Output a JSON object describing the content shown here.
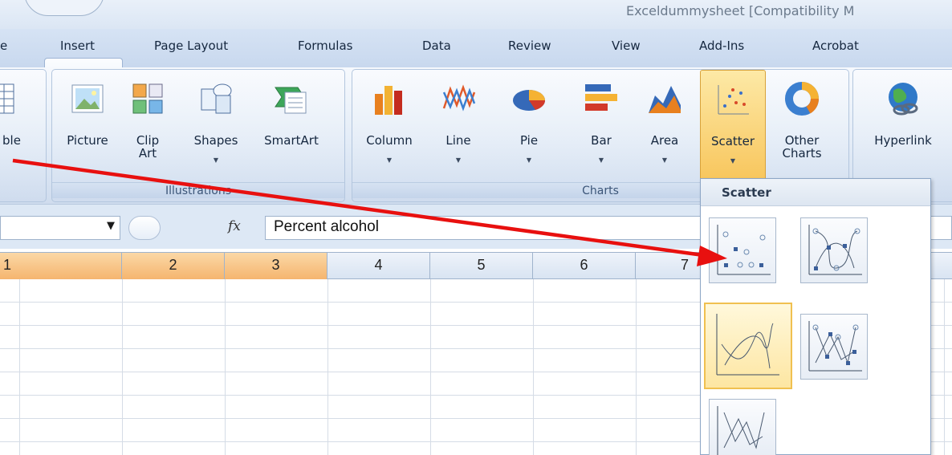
{
  "window": {
    "title": "Exceldummysheet [Compatibility M"
  },
  "tabs": [
    "e",
    "Insert",
    "Page Layout",
    "Formulas",
    "Data",
    "Review",
    "View",
    "Add-Ins",
    "Acrobat"
  ],
  "ribbon": {
    "tables_partial_label": "ble",
    "illustrations": {
      "label": "Illustrations",
      "buttons": [
        "Picture",
        "Clip\nArt",
        "Shapes",
        "SmartArt"
      ]
    },
    "charts": {
      "label": "Charts",
      "buttons": [
        "Column",
        "Line",
        "Pie",
        "Bar",
        "Area",
        "Scatter",
        "Other\nCharts"
      ]
    },
    "links": {
      "buttons": [
        "Hyperlink"
      ]
    }
  },
  "formula_bar": {
    "fx": "fx",
    "value": "Percent alcohol"
  },
  "columns": [
    "1",
    "2",
    "3",
    "4",
    "5",
    "6",
    "7"
  ],
  "scatter_menu": {
    "title": "Scatter"
  },
  "colors": {
    "accent": "#f8c65d",
    "arrow": "#e8100f",
    "selected_col": "#f5b56f"
  }
}
